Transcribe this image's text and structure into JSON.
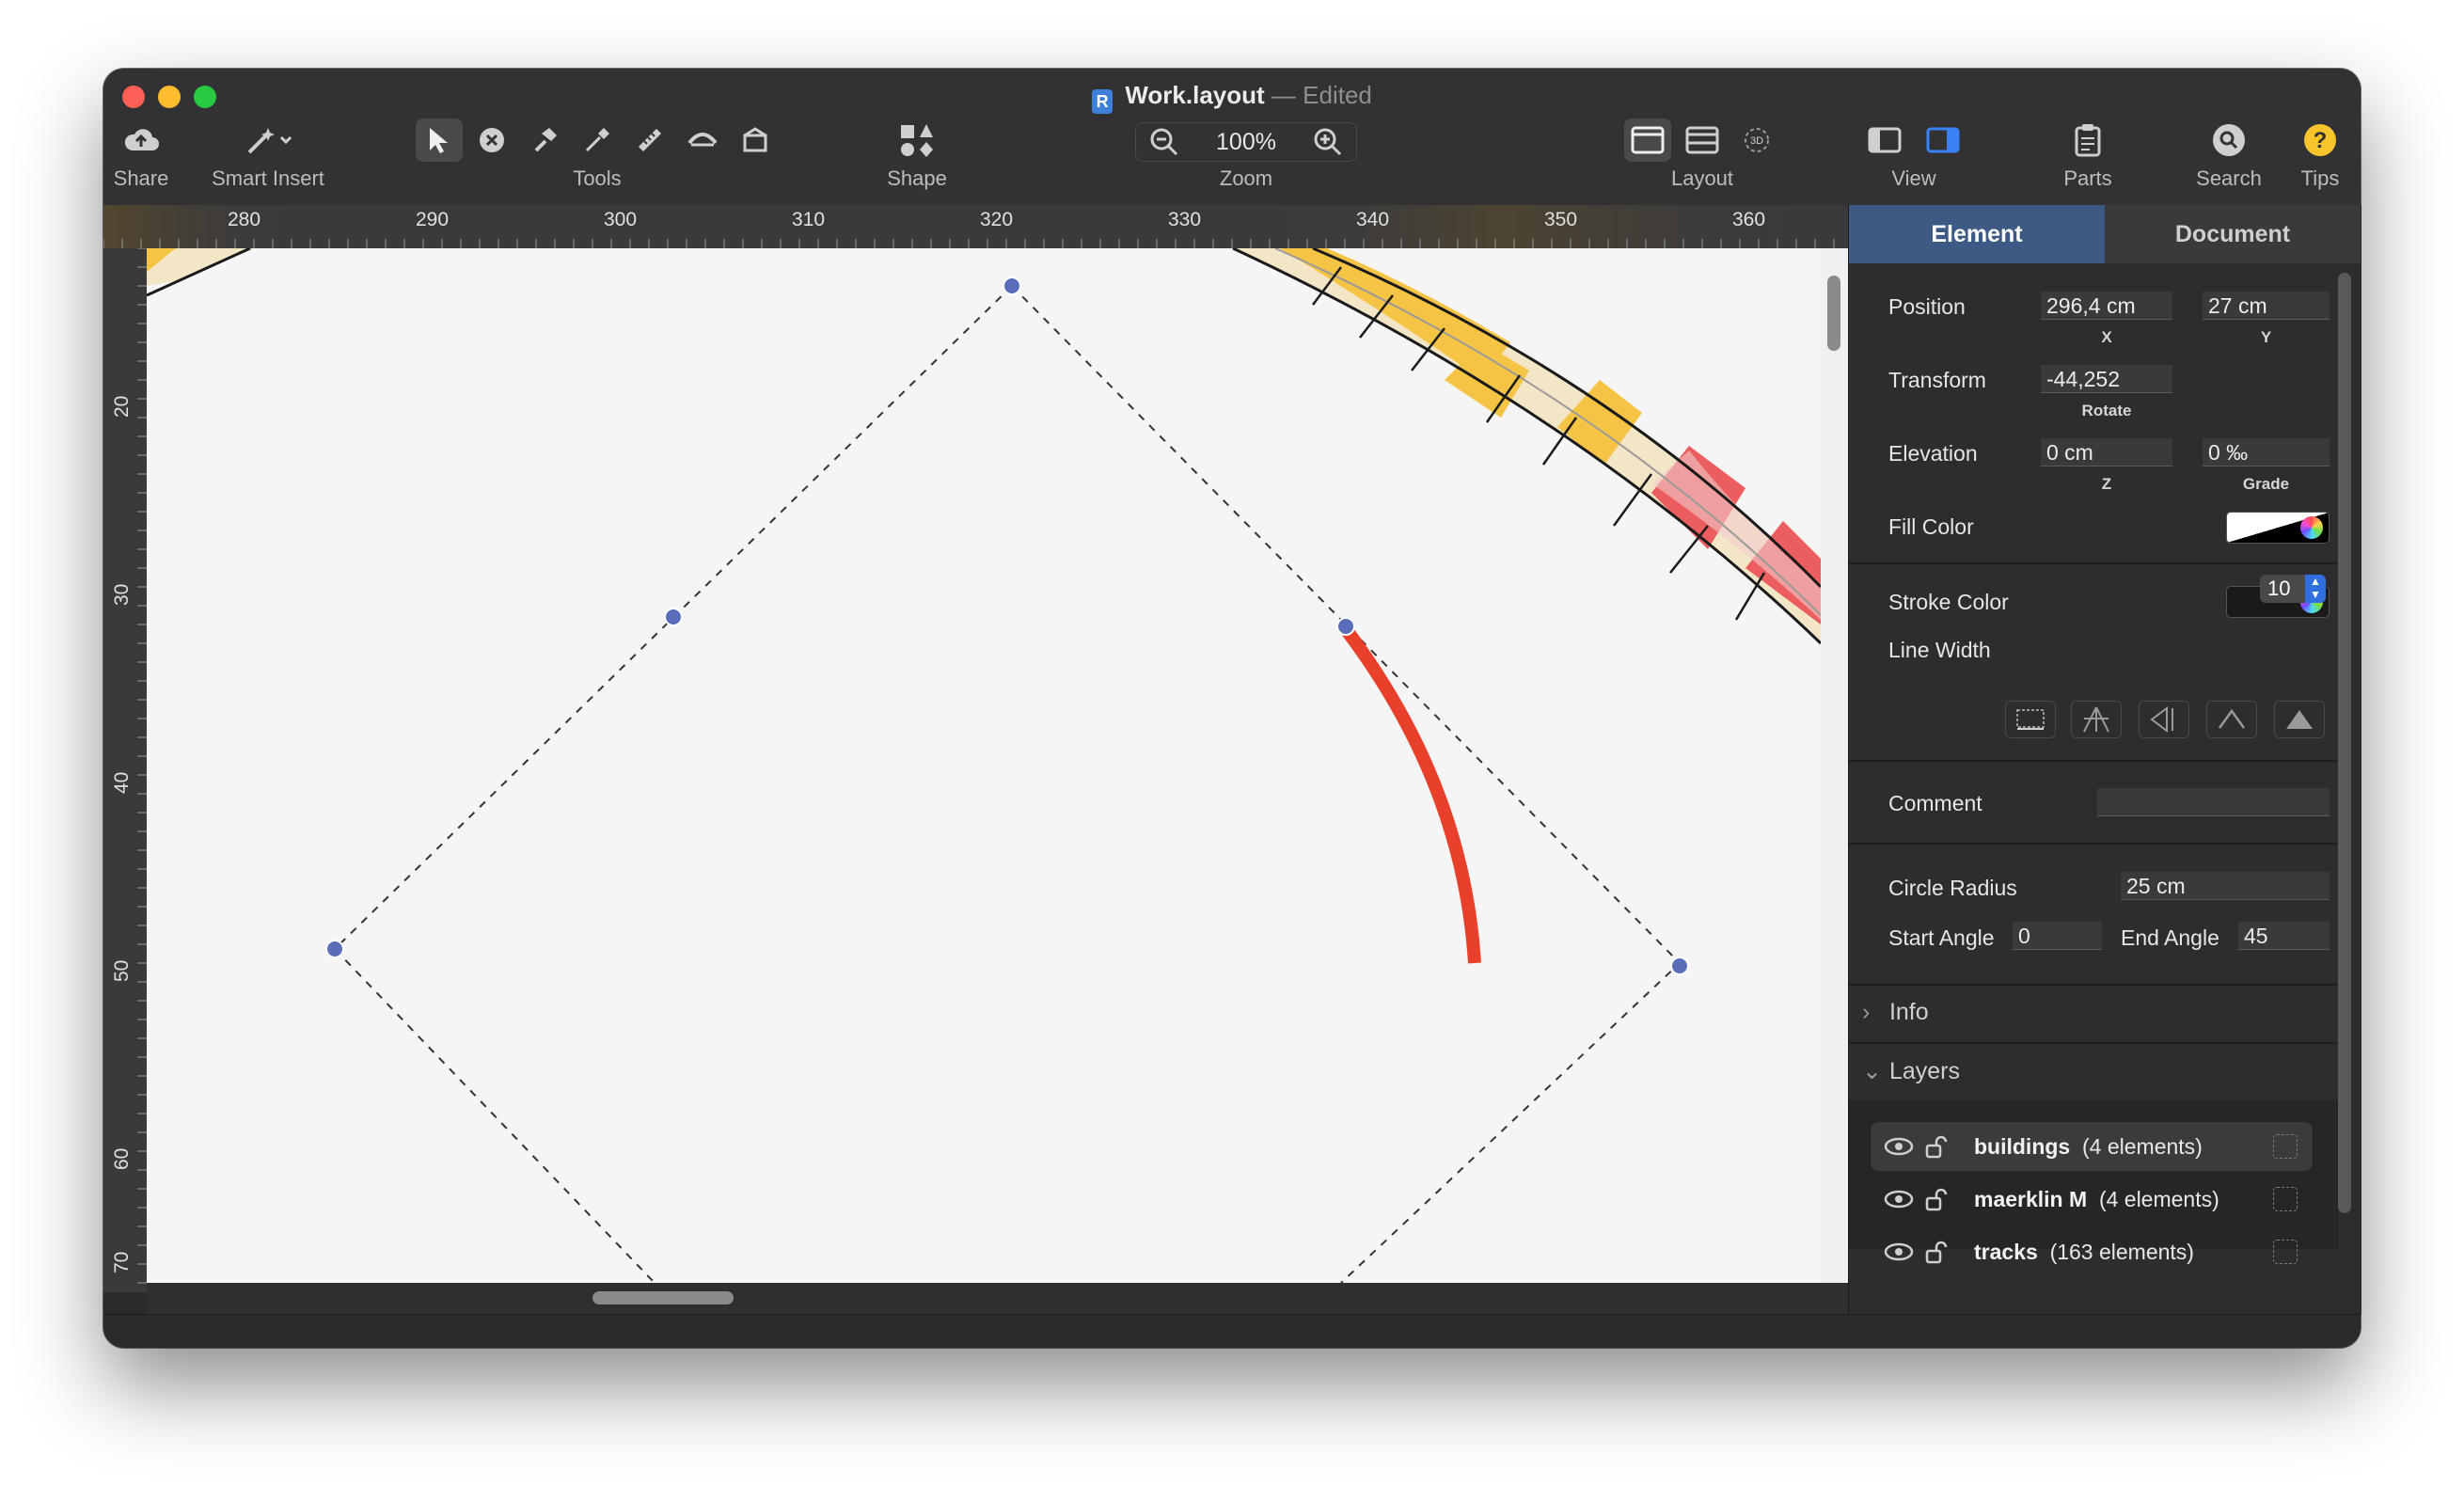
{
  "window": {
    "title_name": "Work.layout",
    "title_separator": "—",
    "title_status": "Edited"
  },
  "toolbar": {
    "share": "Share",
    "smart_insert": "Smart Insert",
    "tools": "Tools",
    "shape": "Shape",
    "zoom": "Zoom",
    "zoom_value": "100%",
    "layout": "Layout",
    "view": "View",
    "parts": "Parts",
    "search": "Search",
    "tips": "Tips",
    "layout_3d": "3D"
  },
  "ruler": {
    "top": [
      "280",
      "290",
      "300",
      "310",
      "320",
      "330",
      "340",
      "350",
      "360"
    ],
    "left": [
      "20",
      "30",
      "40",
      "50",
      "60",
      "70"
    ]
  },
  "inspector": {
    "tabs": {
      "element": "Element",
      "document": "Document"
    },
    "position": {
      "label": "Position",
      "x": "296,4 cm",
      "y": "27 cm",
      "x_label": "X",
      "y_label": "Y"
    },
    "transform": {
      "label": "Transform",
      "rotate": "-44,252",
      "rotate_label": "Rotate"
    },
    "elevation": {
      "label": "Elevation",
      "z": "0 cm",
      "grade": "0 ‰",
      "z_label": "Z",
      "grade_label": "Grade"
    },
    "fill_color": {
      "label": "Fill Color"
    },
    "stroke_color": {
      "label": "Stroke Color"
    },
    "line_width": {
      "label": "Line Width",
      "value": "10"
    },
    "comment": {
      "label": "Comment",
      "value": ""
    },
    "circle_radius": {
      "label": "Circle Radius",
      "value": "25 cm"
    },
    "start_angle": {
      "label": "Start Angle",
      "value": "0"
    },
    "end_angle": {
      "label": "End Angle",
      "value": "45"
    },
    "info": "Info",
    "layers": "Layers"
  },
  "layers": [
    {
      "name": "buildings",
      "count": "(4 elements)",
      "selected": true
    },
    {
      "name": "maerklin M",
      "count": "(4 elements)",
      "selected": false
    },
    {
      "name": "tracks",
      "count": "(163 elements)",
      "selected": false
    }
  ],
  "colors": {
    "arc_stroke": "#e8402a",
    "handle": "#5a6db8",
    "track_yellow": "#f6c445",
    "track_red": "#ec5d5f",
    "accent_tab": "#3c5a84"
  }
}
